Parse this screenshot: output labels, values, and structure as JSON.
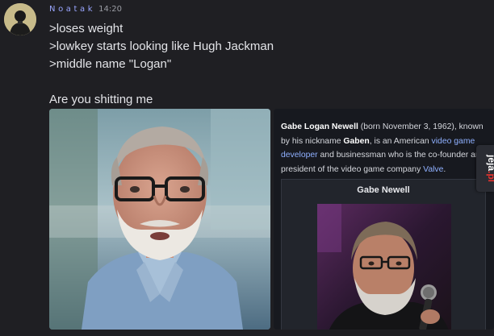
{
  "message": {
    "username": "Noatak",
    "timestamp": "14:20",
    "lines": [
      ">loses weight",
      ">lowkey starts looking like Hugh Jackman",
      ">middle name \"Logan\""
    ],
    "comment": "Are you shitting me"
  },
  "attachment_right": {
    "wiki_text": {
      "name": "Gabe Logan Newell",
      "born": " (born November 3, 1962), known by his nickname ",
      "nickname": "Gaben",
      "is_an": ", is an American ",
      "link1": "video game developer",
      "and_business": " and businessman who is the co-founder and president of the video game company ",
      "link2": "Valve",
      "period": "."
    },
    "infobox_title": "Gabe Newell"
  },
  "watermark": {
    "text": "jeja.pl"
  },
  "colors": {
    "background": "#1f1f23",
    "username": "#9aa6ff",
    "message_text": "#e3e4e8",
    "link": "#8fb0ff",
    "watermark_accent": "#e8332e"
  },
  "icons": {
    "avatar": "user-avatar-silhouette"
  }
}
